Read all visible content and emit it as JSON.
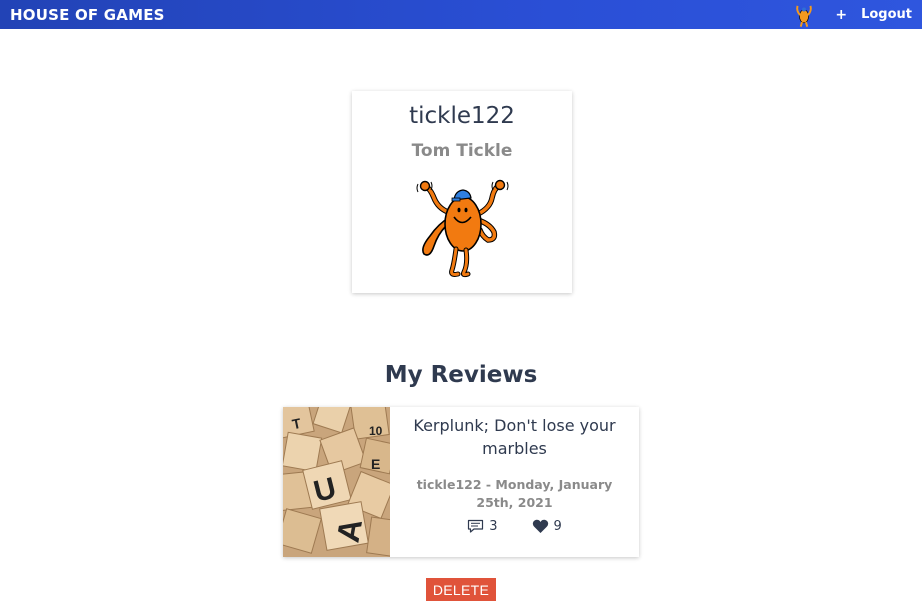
{
  "navbar": {
    "brand": "HOUSE OF GAMES",
    "avatar_icon": "mr-tickle-avatar-icon",
    "plus_label": "+",
    "logout_label": "Logout",
    "bg_color": "#2a4fd6"
  },
  "profile": {
    "username": "tickle122",
    "name": "Tom Tickle",
    "avatar_icon": "mr-tickle-icon"
  },
  "reviews_section": {
    "title": "My Reviews",
    "reviews": [
      {
        "title": "Kerplunk; Don't lose your marbles",
        "author_date": "tickle122 - Monday, January 25th, 2021",
        "comment_count": "3",
        "votes": "9",
        "image_icon": "scrabble-tiles-image",
        "comment_icon": "comment-icon",
        "heart_icon": "heart-icon"
      }
    ]
  },
  "delete_label": "DELETE",
  "colors": {
    "accent": "#2a4fd6",
    "delete": "#e0533a",
    "text": "#2f3a4f",
    "muted": "#8a8a8a"
  }
}
